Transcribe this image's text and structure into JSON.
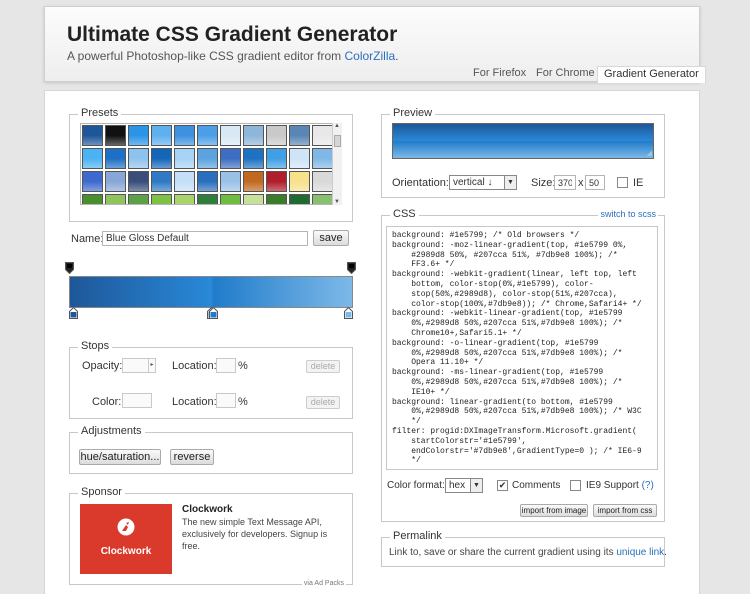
{
  "header": {
    "title": "Ultimate CSS Gradient Generator",
    "subtitle_prefix": "A powerful Photoshop-like CSS gradient editor from ",
    "subtitle_link": "ColorZilla",
    "subtitle_suffix": ".",
    "tabs": [
      {
        "label": "For Firefox",
        "active": false
      },
      {
        "label": "For Chrome",
        "active": false
      },
      {
        "label": "Gradient Generator",
        "active": true
      }
    ]
  },
  "presets": {
    "legend": "Presets",
    "swatches": [
      [
        "#1e5799",
        "#111111",
        "#2a94e6",
        "#5fb0ef",
        "#3d91e0",
        "#4c9fe6",
        "#d8e8f4",
        "#8eb6d8",
        "#c9c9c9",
        "#5a86b5",
        "#e8e8e8"
      ],
      [
        "#4bb2f3",
        "#1e6fc6",
        "#8ec3ee",
        "#1466b8",
        "#a6d2f3",
        "#5aa3df",
        "#3d6ec2",
        "#1d72c2",
        "#3fa0e5",
        "#cfe4f7",
        "#7fb8e6"
      ],
      [
        "#3e6ad0",
        "#87a7d6",
        "#3a4e7a",
        "#2f79c5",
        "#c4dff7",
        "#2a6fbd",
        "#9ac1e6",
        "#c06a20",
        "#b01d2b",
        "#f7e18b",
        "#d9d9d9"
      ],
      [
        "#4a8f2d",
        "#90c55e",
        "#5da048",
        "#7dc244",
        "#a9d36b",
        "#2f7e3b",
        "#6ebd41",
        "#c7e09a",
        "#3a7c2a",
        "#1f6b32",
        "#88c070"
      ]
    ]
  },
  "name": {
    "label": "Name:",
    "value": "Blue Gloss Default",
    "save_label": "save"
  },
  "stops": {
    "legend": "Stops",
    "opacity_label": "Opacity:",
    "location_label": "Location:",
    "percent": "%",
    "color_label": "Color:",
    "delete_label": "delete"
  },
  "adjustments": {
    "legend": "Adjustments",
    "hue_label": "hue/saturation...",
    "reverse_label": "reverse"
  },
  "sponsor": {
    "legend": "Sponsor",
    "ad_brand": "Clockwork",
    "title": "Clockwork",
    "text": "The new simple Text Message API, exclusively for developers. Signup is free.",
    "via": "via Ad Packs"
  },
  "preview": {
    "legend": "Preview",
    "orientation_label": "Orientation:",
    "orientation_value": "vertical ↓",
    "size_label": "Size:",
    "width": "370",
    "x": "x",
    "height": "50",
    "ie_label": "IE"
  },
  "css": {
    "legend": "CSS",
    "switch_link": "switch to scss",
    "code_lines": [
      "background: #1e5799; /* Old browsers */",
      "background: -moz-linear-gradient(top, #1e5799 0%,",
      "    #2989d8 50%, #207cca 51%, #7db9e8 100%); /*",
      "    FF3.6+ */",
      "background: -webkit-gradient(linear, left top, left",
      "    bottom, color-stop(0%,#1e5799), color-",
      "    stop(50%,#2989d8), color-stop(51%,#207cca),",
      "    color-stop(100%,#7db9e8)); /* Chrome,Safari4+ */",
      "background: -webkit-linear-gradient(top, #1e5799",
      "    0%,#2989d8 50%,#207cca 51%,#7db9e8 100%); /*",
      "    Chrome10+,Safari5.1+ */",
      "background: -o-linear-gradient(top, #1e5799",
      "    0%,#2989d8 50%,#207cca 51%,#7db9e8 100%); /*",
      "    Opera 11.10+ */",
      "background: -ms-linear-gradient(top, #1e5799",
      "    0%,#2989d8 50%,#207cca 51%,#7db9e8 100%); /*",
      "    IE10+ */",
      "background: linear-gradient(to bottom, #1e5799",
      "    0%,#2989d8 50%,#207cca 51%,#7db9e8 100%); /* W3C",
      "    */",
      "filter: progid:DXImageTransform.Microsoft.gradient(",
      "    startColorstr='#1e5799',",
      "    endColorstr='#7db9e8',GradientType=0 ); /* IE6-9",
      "    */"
    ],
    "color_format_label": "Color format:",
    "color_format_value": "hex",
    "comments_label": "Comments",
    "ie9_label": "IE9 Support",
    "ie9_help": "(?)",
    "import_image_label": "import from image",
    "import_css_label": "import from css"
  },
  "permalink": {
    "legend": "Permalink",
    "text": "Link to, save or share the current gradient using its ",
    "link": "unique link",
    "suffix": "."
  },
  "gradient_stops": [
    {
      "color": "#1e5799",
      "position": 0
    },
    {
      "color": "#2989d8",
      "position": 50
    },
    {
      "color": "#207cca",
      "position": 51
    },
    {
      "color": "#7db9e8",
      "position": 100
    }
  ]
}
